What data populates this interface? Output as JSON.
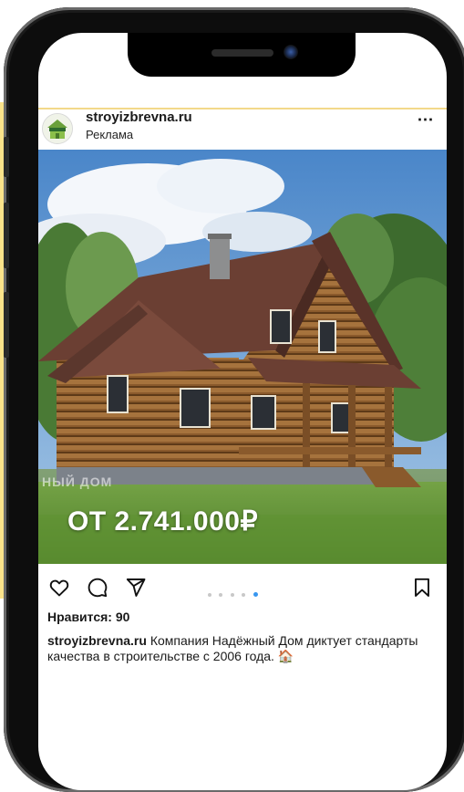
{
  "post": {
    "username": "stroyizbrevna.ru",
    "sponsored_label": "Реклама",
    "more_icon": "⋯",
    "image_overlay": {
      "price": "ОТ 2.741.000₽",
      "watermark": "НЫЙ ДОМ"
    },
    "carousel": {
      "count": 5,
      "active_index": 4
    },
    "likes": "Нравится: 90",
    "caption_username": "stroyizbrevna.ru",
    "caption_text": "Компания Надёжный Дом диктует стандарты качества в строительстве с 2006 года. 🏠"
  },
  "icons": {
    "like": "heart-icon",
    "comment": "comment-icon",
    "share": "share-icon",
    "save": "bookmark-icon"
  },
  "colors": {
    "accent_strip": "#fbe38a",
    "carousel_active": "#3897f0"
  }
}
